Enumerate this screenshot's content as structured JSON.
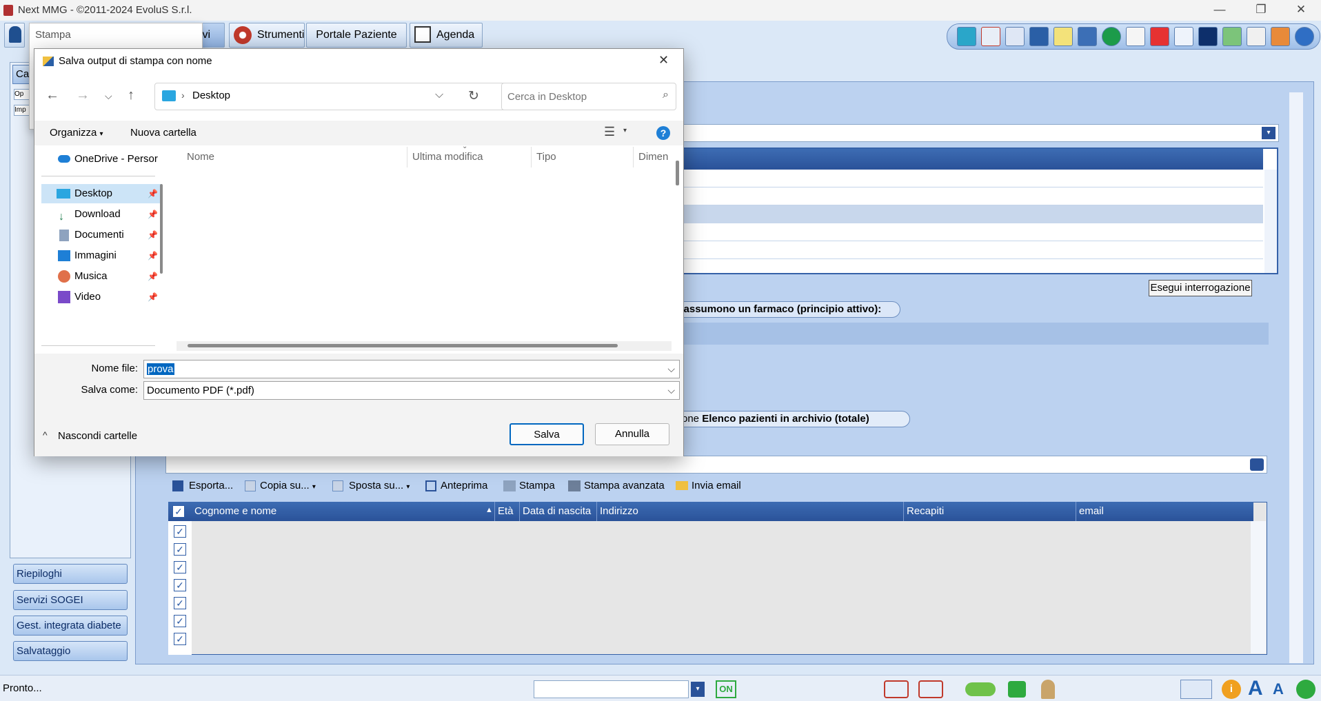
{
  "window": {
    "title": "Next MMG - ©2011-2024 EvoluS S.r.l.",
    "minimize_glyph": "—",
    "maximize_glyph": "❐",
    "close_glyph": "✕"
  },
  "toolbar": {
    "archivi_label": "hivi",
    "strumenti_label": "Strumenti",
    "portale_label": "Portale Paziente",
    "agenda_label": "Agenda",
    "dropdown_glyph": "▾"
  },
  "print_popup": {
    "placeholder": "Stampa",
    "partial_items": [
      "Op",
      "Imp"
    ]
  },
  "left_nav": {
    "top_tab": "Ca",
    "items": [
      "Riepiloghi",
      "Servizi SOGEI",
      "Gest. integrata diabete",
      "Salvataggio"
    ]
  },
  "main": {
    "run_query_button": "Esegui interrogazione",
    "query2_title": "e assumono un farmaco (principio attivo):",
    "query3_prefix": "one",
    "query3_title": "Elenco pazienti in archivio (totale)",
    "grid_toolbar": [
      "Esporta...",
      "Copia su...",
      "Sposta su...",
      "Anteprima",
      "Stampa",
      "Stampa avanzata",
      "Invia email"
    ],
    "grid_columns": [
      "Cognome e nome",
      "Età",
      "Data di nascita",
      "Indirizzo",
      "Recapiti",
      "email"
    ],
    "checkbox_glyph": "✓"
  },
  "dialog": {
    "title": "Salva output di stampa con nome",
    "close_glyph": "✕",
    "location": "Desktop",
    "search_placeholder": "Cerca in Desktop",
    "organize_label": "Organizza",
    "new_folder_label": "Nuova cartella",
    "help_glyph": "?",
    "tree": [
      {
        "label": "OneDrive - Persor",
        "icon": "cloud-icon",
        "pinned": false
      },
      {
        "label": "Desktop",
        "icon": "desktop-icon",
        "pinned": true
      },
      {
        "label": "Download",
        "icon": "download-icon",
        "pinned": true
      },
      {
        "label": "Documenti",
        "icon": "documents-icon",
        "pinned": true
      },
      {
        "label": "Immagini",
        "icon": "pictures-icon",
        "pinned": true
      },
      {
        "label": "Musica",
        "icon": "music-icon",
        "pinned": true
      },
      {
        "label": "Video",
        "icon": "video-icon",
        "pinned": true
      }
    ],
    "pin_glyph": "📌",
    "columns": [
      "Nome",
      "Ultima modifica",
      "Tipo",
      "Dimen"
    ],
    "filename_label": "Nome file:",
    "filename_value": "prova",
    "savetype_label": "Salva come:",
    "savetype_value": "Documento PDF (*.pdf)",
    "save_button": "Salva",
    "cancel_button": "Annulla",
    "hide_folders": "Nascondi cartelle"
  },
  "statusbar": {
    "status_text": "Pronto...",
    "on_badge": "ON"
  },
  "colors": {
    "header_blue": "#2a5299",
    "panel_blue": "#bcd2f0",
    "selection_blue": "#0067c0"
  }
}
